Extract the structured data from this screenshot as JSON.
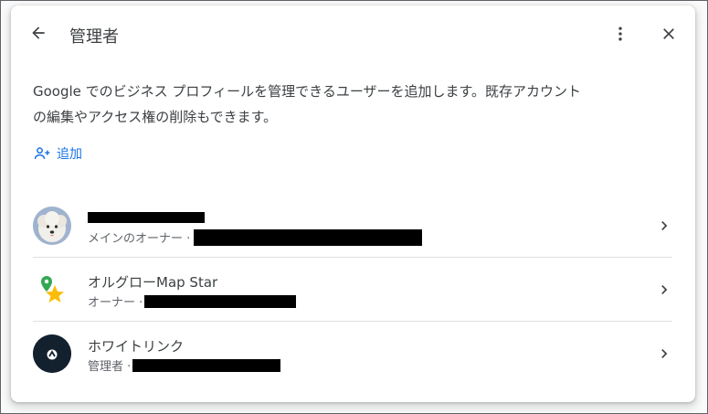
{
  "header": {
    "title": "管理者",
    "back_icon": "arrow-back-icon",
    "more_icon": "more-vert-icon",
    "close_icon": "close-icon"
  },
  "description": {
    "line1": "Google でのビジネス プロフィールを管理できるユーザーを追加します。既存アカウント",
    "line2": "の編集やアクセス権の削除もできます。"
  },
  "add": {
    "label": "追加",
    "icon": "person-add-icon",
    "color": "#1a73e8"
  },
  "users": [
    {
      "name": "",
      "role": "メインのオーナー · ",
      "avatar": "dog-photo-avatar"
    },
    {
      "name": "オルグローMap Star",
      "role": "オーナー · ",
      "avatar": "map-pin-star-avatar"
    },
    {
      "name": "ホワイトリンク",
      "role": "管理者 · ",
      "avatar": "dark-logo-avatar"
    }
  ]
}
